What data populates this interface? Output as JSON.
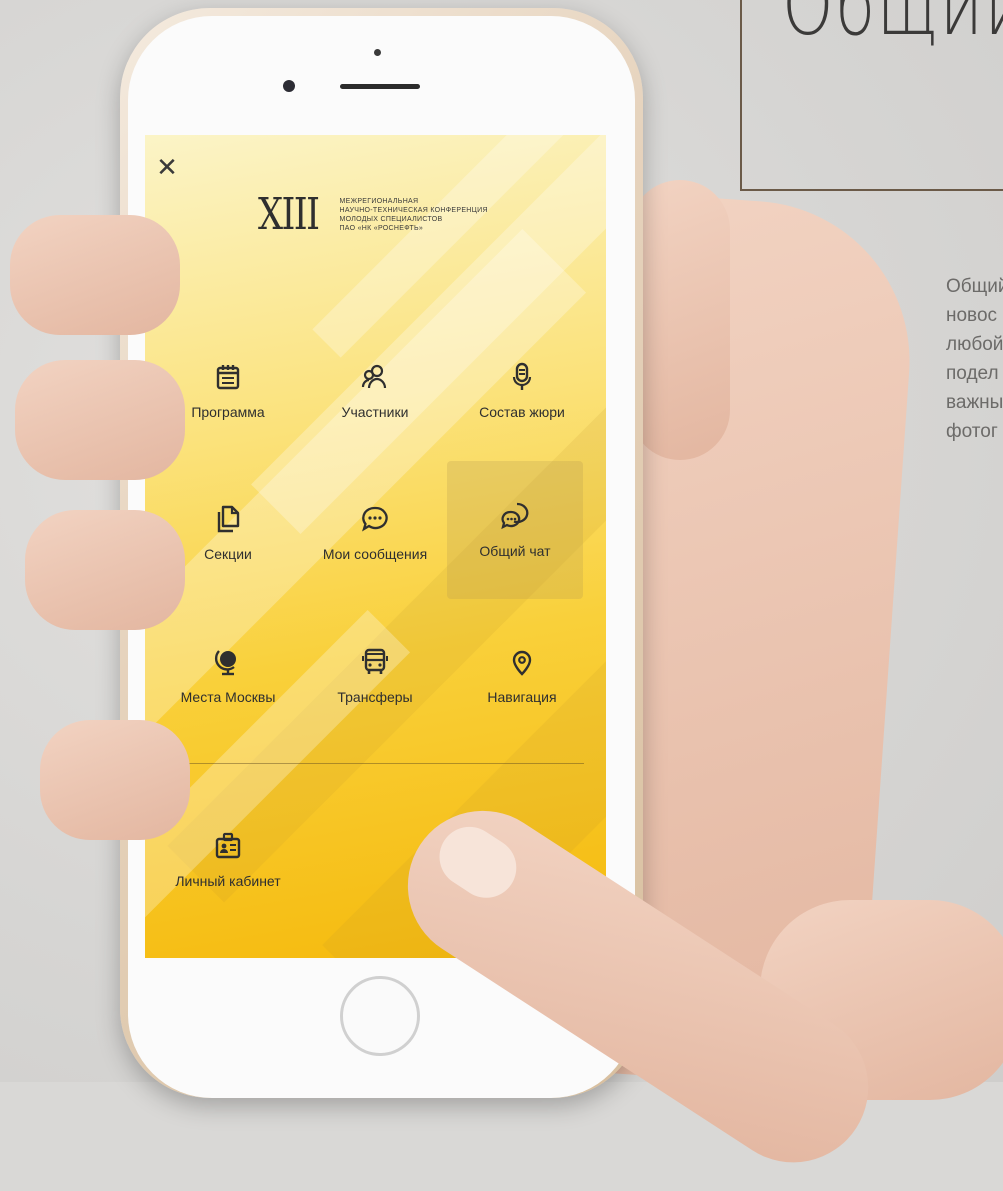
{
  "headline": {
    "text": "Общий"
  },
  "description": {
    "lines": [
      "Общий",
      "новос",
      "любой",
      "подел",
      "важны",
      "фотог"
    ]
  },
  "app": {
    "close_icon": "close-icon",
    "logo": {
      "numeral": "XIII",
      "lines": [
        "Межрегиональная",
        "научно-техническая конференция",
        "молодых специалистов",
        "ПАО «НК «Роснефть»"
      ]
    },
    "menu": [
      {
        "label": "Программа",
        "icon": "calendar-icon"
      },
      {
        "label": "Участники",
        "icon": "users-icon"
      },
      {
        "label": "Состав жюри",
        "icon": "microphone-icon"
      },
      {
        "label": "Секции",
        "icon": "documents-icon"
      },
      {
        "label": "Мои сообщения",
        "icon": "chat-bubble-icon"
      },
      {
        "label": "Общий чат",
        "icon": "group-chat-icon",
        "active": true
      },
      {
        "label": "Места Москвы",
        "icon": "globe-icon"
      },
      {
        "label": "Трансферы",
        "icon": "bus-icon"
      },
      {
        "label": "Навигация",
        "icon": "location-pin-icon"
      },
      {
        "label": "Личный кабинет",
        "icon": "id-badge-icon"
      }
    ]
  },
  "colors": {
    "accent": "#f9d03a",
    "accent_dark": "#f5b90b",
    "text": "#2f2f2f",
    "frame": "#6b5a48"
  }
}
